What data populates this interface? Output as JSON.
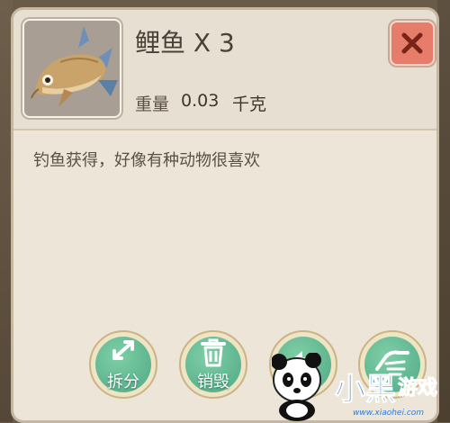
{
  "item": {
    "name": "鲤鱼 X 3",
    "weight_label": "重量",
    "weight_value": "0.03",
    "weight_unit": "千克",
    "icon": "fish-icon",
    "description": "钓鱼获得，好像有种动物很喜欢"
  },
  "close": {
    "icon": "close-icon"
  },
  "actions": [
    {
      "label": "拆分",
      "icon": "split-arrows-icon"
    },
    {
      "label": "销毁",
      "icon": "trash-icon"
    },
    {
      "label": "",
      "icon": "send-arrow-icon"
    },
    {
      "label": "",
      "icon": "hand-icon"
    }
  ],
  "watermark": {
    "text": "小黑游戏",
    "url": "www.xiaohei.com"
  },
  "colors": {
    "panel": "#ede5d8",
    "action_button": "#5fb894",
    "close_button": "#e67d6a"
  }
}
